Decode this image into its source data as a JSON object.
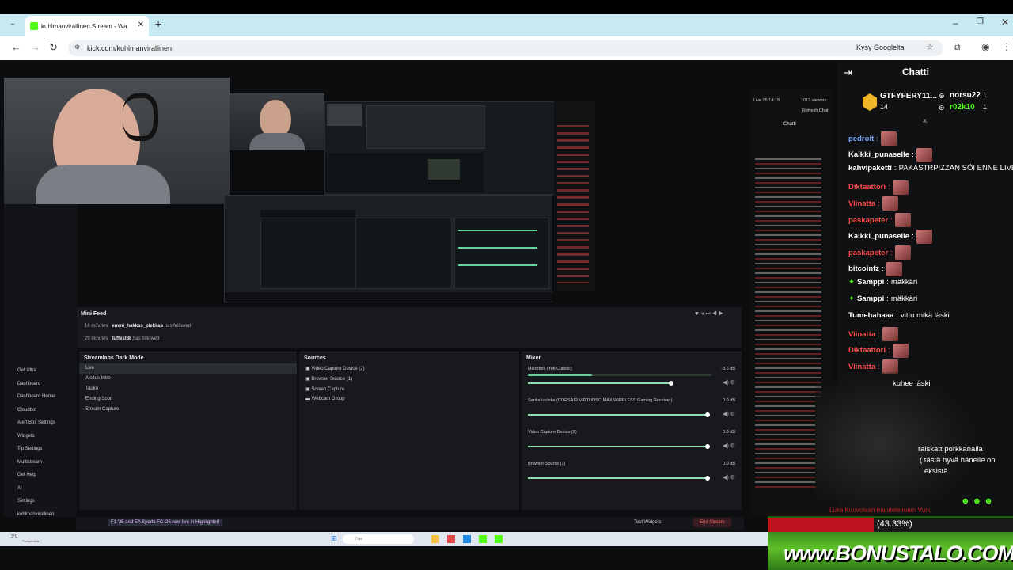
{
  "browser": {
    "tab_title": "kuhlmanvirallinen Stream - Wa",
    "url": "kick.com/kuhlmanvirallinen",
    "ask_google": "Kysy Googlelta"
  },
  "obs": {
    "live_time": "Live 05:14:18",
    "viewers": "1012 viewers",
    "refresh_chat": "Refresh Chat",
    "chat_title": "Chatti",
    "minifeed": {
      "title": "Mini Feed",
      "items": [
        {
          "time": "16 minutes",
          "user": "emmi_hakkas_plekkas",
          "action": "has followed"
        },
        {
          "time": "29 minutes",
          "user": "tuffest88",
          "action": "has followed"
        }
      ]
    },
    "scenes": {
      "title": "Streamlabs Dark Mode",
      "items": [
        "Live",
        "Aloitus Intro",
        "Tauko",
        "Ending Soon",
        "Stream Capture"
      ]
    },
    "sources": {
      "title": "Sources",
      "items": [
        "Video Capture Device (2)",
        "Browser Source (1)",
        "Screen Capture",
        "Webcam Group"
      ]
    },
    "mixer": {
      "title": "Mixer",
      "items": [
        {
          "name": "Mikrofoni (Yeti Classic)",
          "db": "-3.6 dB",
          "level": 0.78
        },
        {
          "name": "Sankakuuloke (CORSAIR VIRTUOSO MAX WIRELESS Gaming Receiver)",
          "db": "0.0 dB",
          "level": 0.98
        },
        {
          "name": "Video Capture Device (2)",
          "db": "0.0 dB",
          "level": 0.98
        },
        {
          "name": "Browser Source (1)",
          "db": "0.0 dB",
          "level": 0.98
        }
      ]
    },
    "leftnav": [
      "Get Ultra",
      "Dashboard",
      "Dashboard Home",
      "Cloudbot",
      "Alert Box Settings",
      "Widgets",
      "Tip Settings",
      "Multistream",
      "Get Help",
      "AI",
      "Settings",
      "kuhlmanvirallinen"
    ],
    "status_ticker": "F1 '25 and EA Sports FC '26 now live in Highlighter!",
    "test_widgets": "Test Widgets",
    "end_stream": "End Stream",
    "taskbar_search": "Hae",
    "weather": "3°C",
    "weather_desc": "Puolipilvistä"
  },
  "chat": {
    "title": "Chatti",
    "gifters": [
      {
        "name": "GTFYFERY11...",
        "count": "14"
      },
      {
        "name": "norsu22",
        "count": "1"
      },
      {
        "name": "r02k10",
        "count": "1"
      }
    ],
    "messages": [
      {
        "user": "pedroit",
        "color": "#7aa7ff",
        "text": "",
        "emote": true
      },
      {
        "user": "Kaikki_punaselle",
        "color": "#ffffff",
        "text": "",
        "emote": true
      },
      {
        "user": "kahvipaketti",
        "color": "#ffffff",
        "text": "PAKASTRPIZZAN SÖI ENNE LIVEÄ",
        "emote": false
      },
      {
        "user": "Diktaattori",
        "color": "#ff4d4d",
        "text": "",
        "emote": true
      },
      {
        "user": "Viinatta",
        "color": "#ff4d4d",
        "text": "",
        "emote": true
      },
      {
        "user": "paskapeter",
        "color": "#ff4d4d",
        "text": "",
        "emote": true
      },
      {
        "user": "Kaikki_punaselle",
        "color": "#ffffff",
        "text": "",
        "emote": true
      },
      {
        "user": "paskapeter",
        "color": "#ff4d4d",
        "text": "",
        "emote": true
      },
      {
        "user": "bitcoinfz",
        "color": "#ffffff",
        "text": "",
        "emote": true
      },
      {
        "user": "Samppi",
        "color": "#ffffff",
        "text": "mäkkäri",
        "emote": false,
        "badge": true
      },
      {
        "user": "Samppi",
        "color": "#ffffff",
        "text": "mäkkäri",
        "emote": false,
        "badge": true
      },
      {
        "user": "Tumehahaaa",
        "color": "#ffffff",
        "text": "vittu mikä läski",
        "emote": false
      },
      {
        "user": "Viinatta",
        "color": "#ff4d4d",
        "text": "",
        "emote": true
      },
      {
        "user": "Diktaattori",
        "color": "#ff4d4d",
        "text": "",
        "emote": true
      },
      {
        "user": "Viinatta",
        "color": "#ff4d4d",
        "text": "",
        "emote": true
      }
    ],
    "partial_1": "kuhee läski",
    "partial_2": "raiskatt   porkkanalla",
    "partial_3": "( tästä hyvä  hänelle on",
    "partial_4": "eksistä",
    "bottom_line": "Luka Kouvolaan maistelemaan Vurk"
  },
  "overlay": {
    "goal_percent": "(43.33%)",
    "goal_value": 43.33,
    "sponsor": "www.BONUSTALO.COM"
  }
}
